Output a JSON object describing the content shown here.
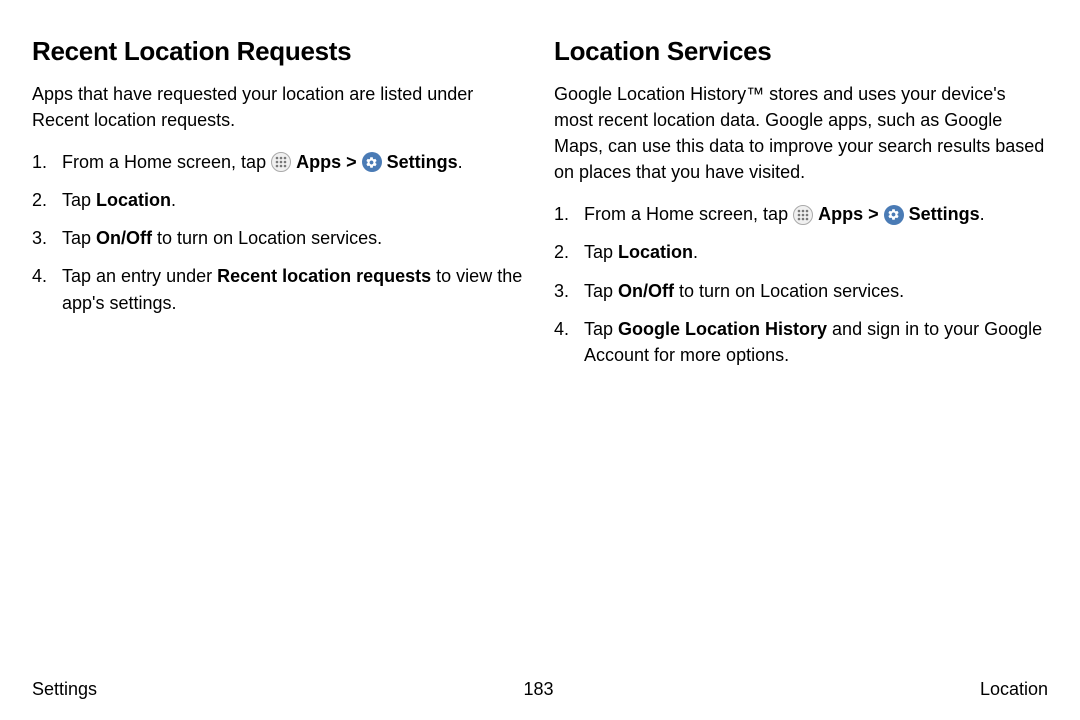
{
  "left": {
    "heading": "Recent Location Requests",
    "intro": "Apps that have requested your location are listed under Recent location requests.",
    "steps": {
      "s1_pre": "From a Home screen, tap ",
      "s1_apps": "Apps",
      "s1_gt": " > ",
      "s1_settings": "Settings",
      "s1_period": ".",
      "s2_pre": "Tap ",
      "s2_bold": "Location",
      "s2_period": ".",
      "s3_pre": "Tap ",
      "s3_bold": "On/Off",
      "s3_post": " to turn on Location services.",
      "s4_pre": "Tap an entry under ",
      "s4_bold": "Recent location requests",
      "s4_post": " to view the app's settings."
    }
  },
  "right": {
    "heading": "Location Services",
    "intro": "Google Location History™ stores and uses your device's most recent location data. Google apps, such as Google Maps, can use this data to improve your search results based on places that you have visited.",
    "steps": {
      "s1_pre": "From a Home screen, tap ",
      "s1_apps": "Apps",
      "s1_gt": " > ",
      "s1_settings": "Settings",
      "s1_period": ".",
      "s2_pre": "Tap ",
      "s2_bold": "Location",
      "s2_period": ".",
      "s3_pre": "Tap ",
      "s3_bold": "On/Off",
      "s3_post": " to turn on Location services.",
      "s4_pre": "Tap ",
      "s4_bold": "Google Location History",
      "s4_post": " and sign in to your Google Account for more options."
    }
  },
  "footer": {
    "left": "Settings",
    "center": "183",
    "right": "Location"
  }
}
